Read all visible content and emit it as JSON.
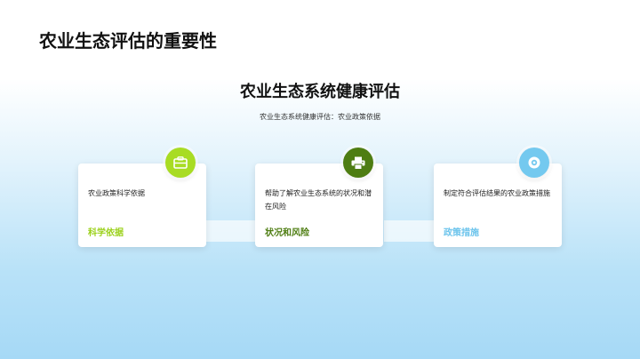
{
  "slide": {
    "title": "农业生态评估的重要性",
    "center_title": "农业生态系统健康评估",
    "center_subtitle": "农业生态系统健康评估：农业政策依据"
  },
  "cards": [
    {
      "description": "农业政策科学依据",
      "tag": "科学依据",
      "tag_color": "#9bd11b",
      "badge_color": "#a8dc23",
      "icon": "briefcase-icon"
    },
    {
      "description": "帮助了解农业生态系统的状况和潜在风险",
      "tag": "状况和风险",
      "tag_color": "#4e7d12",
      "badge_color": "#4e7d12",
      "icon": "printer-icon"
    },
    {
      "description": "制定符合评估结果的农业政策措施",
      "tag": "政策措施",
      "tag_color": "#6cc4ec",
      "badge_color": "#74c9ef",
      "icon": "target-icon"
    }
  ]
}
